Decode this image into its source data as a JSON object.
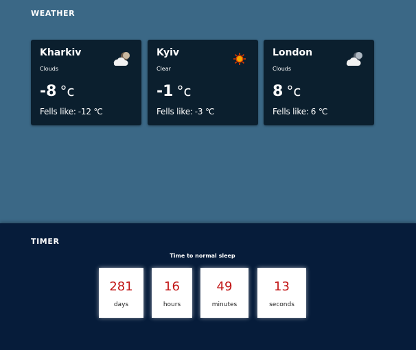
{
  "weather": {
    "title": "WEATHER",
    "cards": [
      {
        "city": "Kharkiv",
        "condition": "Clouds",
        "temp": "-8",
        "unit": "°c",
        "feels_label": "Fells like:",
        "feels_value": "-12 ℃",
        "icon": "cloud-moon-icon"
      },
      {
        "city": "Kyiv",
        "condition": "Clear",
        "temp": "-1",
        "unit": "°c",
        "feels_label": "Fells like:",
        "feels_value": "-3 ℃",
        "icon": "sun-icon"
      },
      {
        "city": "London",
        "condition": "Clouds",
        "temp": "8",
        "unit": "°c",
        "feels_label": "Fells like:",
        "feels_value": "6 ℃",
        "icon": "cloud-moon-icon"
      }
    ]
  },
  "timer": {
    "title": "TIMER",
    "subtitle": "Time to normal sleep",
    "units": [
      {
        "value": "281",
        "label": "days"
      },
      {
        "value": "16",
        "label": "hours"
      },
      {
        "value": "49",
        "label": "minutes"
      },
      {
        "value": "13",
        "label": "seconds"
      }
    ]
  },
  "colors": {
    "weather_bg": "#3b6886",
    "card_bg": "#0b1f2e",
    "timer_bg": "#061c3a",
    "timer_number": "#c11414"
  }
}
